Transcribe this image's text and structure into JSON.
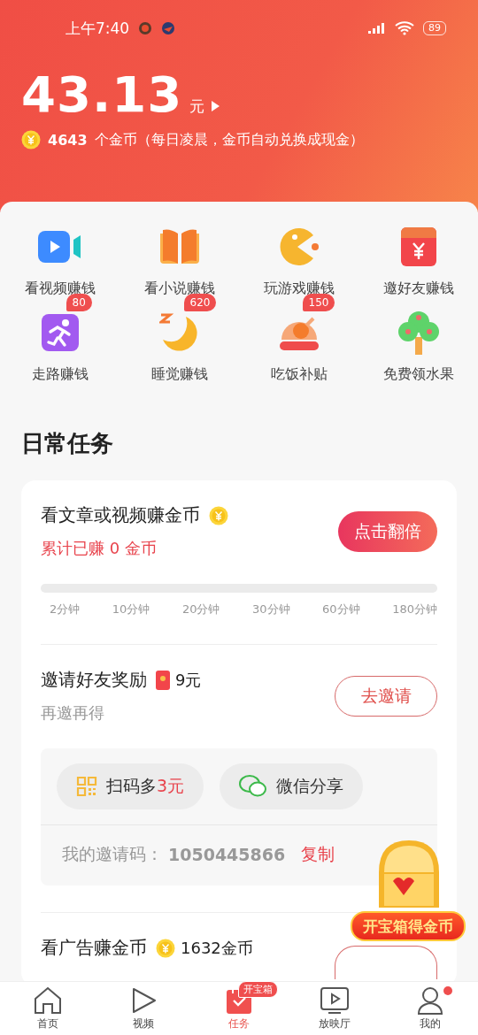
{
  "status_bar": {
    "time": "上午7:40",
    "battery": "89"
  },
  "balance": {
    "amount": "43.13",
    "unit": "元",
    "coins": "4643",
    "coins_note": "个金币（每日凌晨，金币自动兑换成现金）"
  },
  "features": [
    {
      "label": "看视频赚钱"
    },
    {
      "label": "看小说赚钱"
    },
    {
      "label": "玩游戏赚钱"
    },
    {
      "label": "邀好友赚钱"
    },
    {
      "label": "走路赚钱",
      "badge": "80"
    },
    {
      "label": "睡觉赚钱",
      "badge": "620"
    },
    {
      "label": "吃饭补贴",
      "badge": "150"
    },
    {
      "label": "免费领水果"
    }
  ],
  "daily_tasks": {
    "title": "日常任务",
    "tasks": [
      {
        "kind": "progress",
        "title": "看文章或视频赚金币",
        "subtitle": "累计已赚 0 金币",
        "button": "点击翻倍",
        "progress": {
          "level": 0,
          "steps": [
            "2分钟",
            "10分钟",
            "20分钟",
            "30分钟",
            "60分钟",
            "180分钟"
          ]
        }
      },
      {
        "kind": "invite",
        "title": "邀请好友奖励",
        "reward": "9元",
        "subtitle": "再邀再得",
        "button": "去邀请",
        "share_options": [
          {
            "label": "扫码多",
            "highlight": "3元"
          },
          {
            "label": "微信分享"
          }
        ],
        "invite_code_label": "我的邀请码：",
        "invite_code": "1050445866",
        "copy": "复制"
      },
      {
        "kind": "ad",
        "title": "看广告赚金币",
        "reward": "1632金币"
      }
    ]
  },
  "treasure": {
    "label": "开宝箱得金币"
  },
  "nav": [
    {
      "label": "首页",
      "selected": false,
      "dot": false
    },
    {
      "label": "视频",
      "selected": false,
      "dot": false
    },
    {
      "label": "任务",
      "selected": true,
      "dot": false,
      "badge": "开宝箱"
    },
    {
      "label": "放映厅",
      "selected": false,
      "dot": false
    },
    {
      "label": "我的",
      "selected": false,
      "dot": true
    }
  ]
}
